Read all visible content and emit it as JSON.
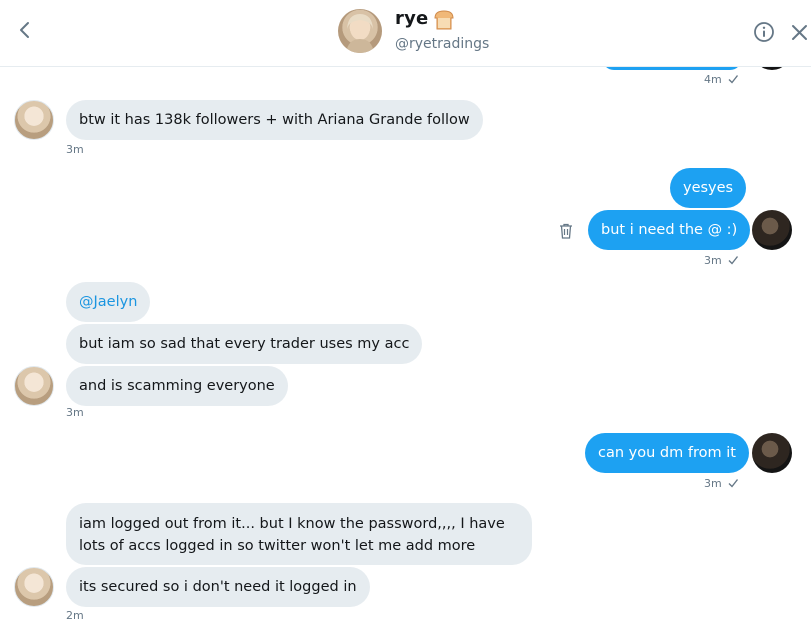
{
  "header": {
    "name": "rye",
    "handle": "@ryetradings",
    "name_emoji_icon": "bread-icon"
  },
  "icons": {
    "back": "chevron-left-icon",
    "info": "info-icon",
    "close": "close-icon",
    "delete": "trash-icon",
    "read": "check-icon"
  },
  "colors": {
    "outgoing_bubble": "#1da1f2",
    "incoming_bubble": "#e6ecf0",
    "mention": "#1b95e0",
    "timestamp": "#657786"
  },
  "messages": {
    "m0_time": "4m",
    "m1_text": "btw it has 138k followers + with Ariana Grande follow",
    "m1_time": "3m",
    "m2_text": "yesyes",
    "m3_text": "but i need the @ :)",
    "m3_time": "3m",
    "m4_text": "@Jaelyn",
    "m5_text": "but iam so sad that every trader uses my acc",
    "m6_text": "and is scamming everyone",
    "m6_time": "3m",
    "m7_text": "can you dm from it",
    "m7_time": "3m",
    "m8_text": "iam logged out from it... but I know the password,,,, I have lots of accs logged in so twitter won't let me add more",
    "m9_text": "its secured so i don't need it logged in",
    "m9_time": "2m"
  }
}
